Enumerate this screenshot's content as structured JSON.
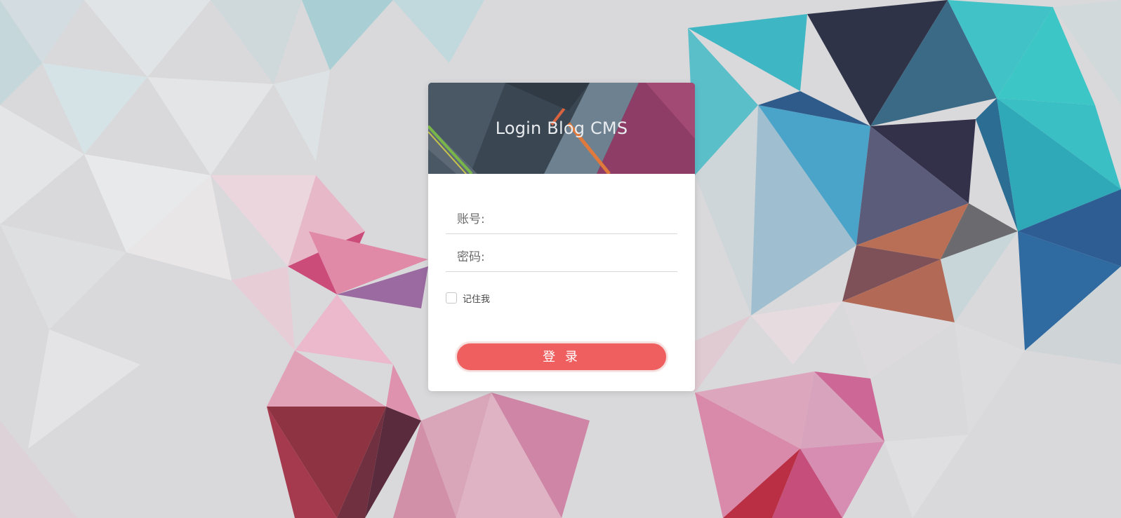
{
  "login_card": {
    "title": "Login Blog CMS",
    "account_placeholder": "账号:",
    "password_placeholder": "密码:",
    "remember_label": "记住我",
    "remember_checked": false,
    "login_button_label": "登 录"
  },
  "colors": {
    "button": "#ef5f5f",
    "header_dark": "#3f4b57",
    "header_magenta": "#8e3d66",
    "card": "#ffffff"
  }
}
